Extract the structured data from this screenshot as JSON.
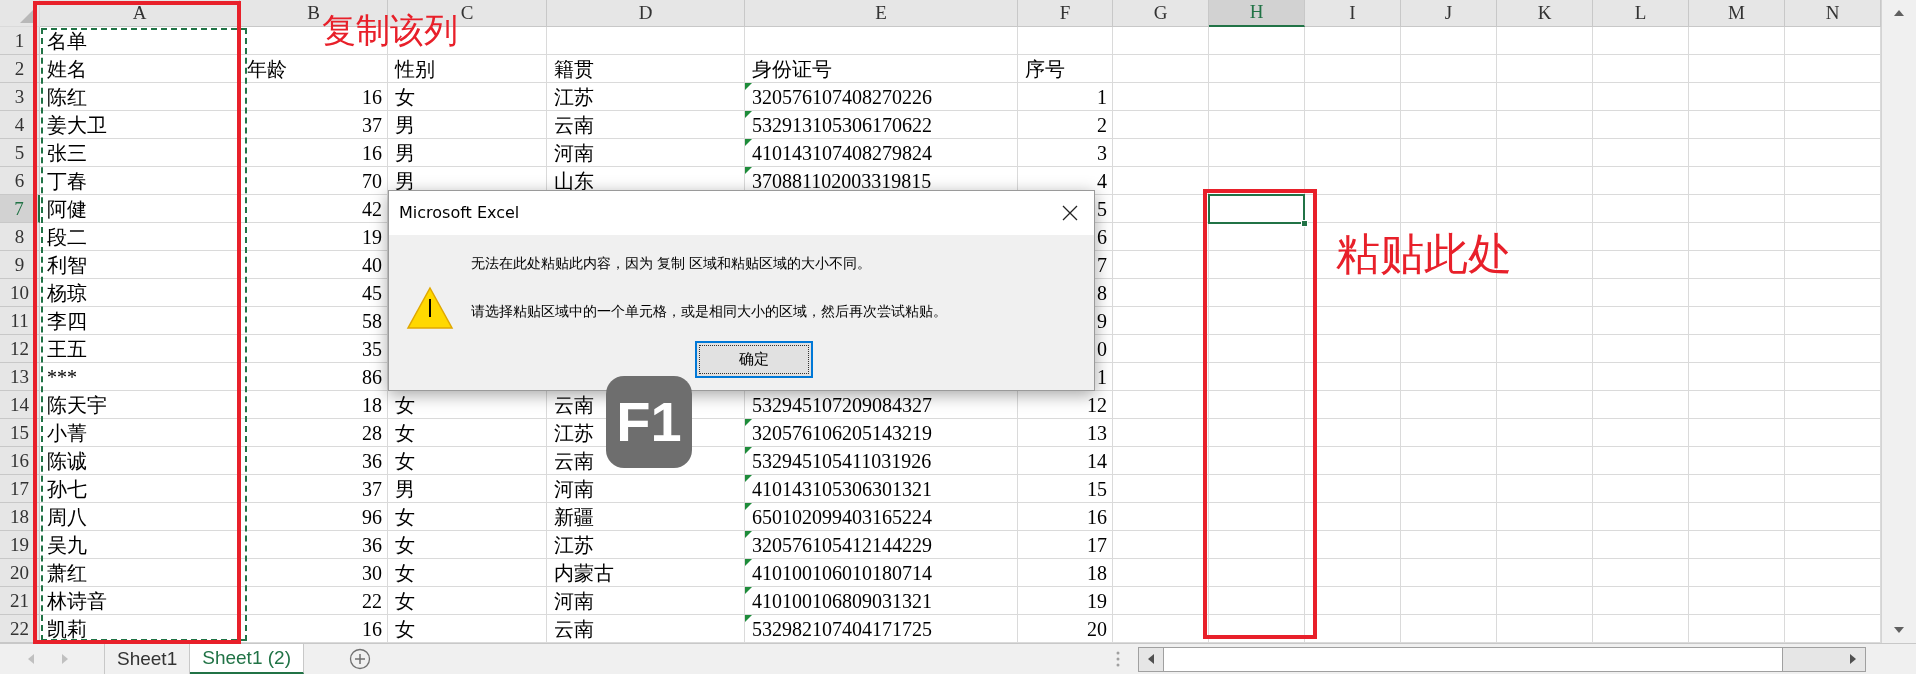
{
  "columns": [
    {
      "label": "A",
      "selected": false
    },
    {
      "label": "B",
      "selected": false
    },
    {
      "label": "C",
      "selected": false
    },
    {
      "label": "D",
      "selected": false
    },
    {
      "label": "E",
      "selected": false
    },
    {
      "label": "F",
      "selected": false
    },
    {
      "label": "G",
      "selected": false
    },
    {
      "label": "H",
      "selected": true
    },
    {
      "label": "I",
      "selected": false
    },
    {
      "label": "J",
      "selected": false
    },
    {
      "label": "K",
      "selected": false
    },
    {
      "label": "L",
      "selected": false
    },
    {
      "label": "M",
      "selected": false
    },
    {
      "label": "N",
      "selected": false
    }
  ],
  "rows": [
    {
      "label": "1",
      "selected": false,
      "kind": "title",
      "name": "名单"
    },
    {
      "label": "2",
      "selected": false,
      "kind": "header",
      "name": "姓名",
      "age": "年龄",
      "gender": "性别",
      "origin": "籍贯",
      "id_number": "身份证号",
      "serial": "序号"
    },
    {
      "label": "3",
      "selected": false,
      "kind": "data",
      "name": "陈红",
      "age": "16",
      "gender": "女",
      "origin": "江苏",
      "id_number": "320576107408270226",
      "serial": "1",
      "flagged": true
    },
    {
      "label": "4",
      "selected": false,
      "kind": "data",
      "name": "姜大卫",
      "age": "37",
      "gender": "男",
      "origin": "云南",
      "id_number": "532913105306170622",
      "serial": "2",
      "flagged": true
    },
    {
      "label": "5",
      "selected": false,
      "kind": "data",
      "name": "张三",
      "age": "16",
      "gender": "男",
      "origin": "河南",
      "id_number": "410143107408279824",
      "serial": "3",
      "flagged": true
    },
    {
      "label": "6",
      "selected": false,
      "kind": "data",
      "name": "丁春",
      "age": "70",
      "gender": "男",
      "origin": "山东",
      "id_number": "370881102003319815",
      "serial": "4",
      "flagged": true
    },
    {
      "label": "7",
      "selected": true,
      "kind": "data",
      "name": "阿健",
      "age": "42",
      "serial": "5"
    },
    {
      "label": "8",
      "selected": false,
      "kind": "data",
      "name": "段二",
      "age": "19",
      "serial": "6"
    },
    {
      "label": "9",
      "selected": false,
      "kind": "data",
      "name": "利智",
      "age": "40",
      "serial": "7"
    },
    {
      "label": "10",
      "selected": false,
      "kind": "data",
      "name": "杨琼",
      "age": "45",
      "serial": "8"
    },
    {
      "label": "11",
      "selected": false,
      "kind": "data",
      "name": "李四",
      "age": "58",
      "serial": "9"
    },
    {
      "label": "12",
      "selected": false,
      "kind": "data",
      "name": "王五",
      "age": "35",
      "serial": "0"
    },
    {
      "label": "13",
      "selected": false,
      "kind": "data",
      "name": "***",
      "age": "86",
      "serial": "1"
    },
    {
      "label": "14",
      "selected": false,
      "kind": "data",
      "name": "陈天宇",
      "age": "18",
      "gender": "女",
      "origin": "云南",
      "id_number": "532945107209084327",
      "serial": "12"
    },
    {
      "label": "15",
      "selected": false,
      "kind": "data",
      "name": "小菁",
      "age": "28",
      "gender": "女",
      "origin": "江苏",
      "id_number": "320576106205143219",
      "serial": "13",
      "flagged": true
    },
    {
      "label": "16",
      "selected": false,
      "kind": "data",
      "name": "陈诚",
      "age": "36",
      "gender": "女",
      "origin": "云南",
      "id_number": "532945105411031926",
      "serial": "14",
      "flagged": true
    },
    {
      "label": "17",
      "selected": false,
      "kind": "data",
      "name": "孙七",
      "age": "37",
      "gender": "男",
      "origin": "河南",
      "id_number": "410143105306301321",
      "serial": "15",
      "flagged": true
    },
    {
      "label": "18",
      "selected": false,
      "kind": "data",
      "name": "周八",
      "age": "96",
      "gender": "女",
      "origin": "新疆",
      "id_number": "650102099403165224",
      "serial": "16",
      "flagged": true
    },
    {
      "label": "19",
      "selected": false,
      "kind": "data",
      "name": "吴九",
      "age": "36",
      "gender": "女",
      "origin": "江苏",
      "id_number": "320576105412144229",
      "serial": "17",
      "flagged": true
    },
    {
      "label": "20",
      "selected": false,
      "kind": "data",
      "name": "萧红",
      "age": "30",
      "gender": "女",
      "origin": "内蒙古",
      "id_number": "410100106010180714",
      "serial": "18",
      "flagged": true
    },
    {
      "label": "21",
      "selected": false,
      "kind": "data",
      "name": "林诗音",
      "age": "22",
      "gender": "女",
      "origin": "河南",
      "id_number": "410100106809031321",
      "serial": "19",
      "flagged": true
    },
    {
      "label": "22",
      "selected": false,
      "kind": "data",
      "name": "凯莉",
      "age": "16",
      "gender": "女",
      "origin": "云南",
      "id_number": "532982107404171725",
      "serial": "20",
      "flagged": true
    }
  ],
  "sheet_tabs": [
    {
      "label": "Sheet1",
      "selected": false
    },
    {
      "label": "Sheet1 (2)",
      "selected": true
    }
  ],
  "dialog": {
    "title": "Microsoft Excel",
    "messages": [
      "无法在此处粘贴此内容，因为 复制 区域和粘贴区域的大小不同。",
      "请选择粘贴区域中的一个单元格，或是相同大小的区域，然后再次尝试粘贴。"
    ],
    "button": "确定"
  },
  "key_badge": "F1",
  "annotations": [
    {
      "text": "复制该列"
    },
    {
      "text": "粘贴此处"
    }
  ]
}
